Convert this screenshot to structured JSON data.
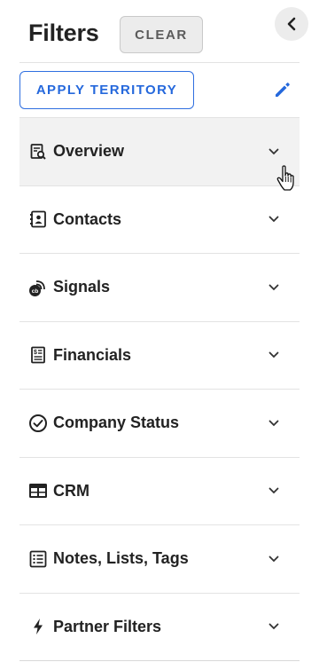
{
  "header": {
    "title": "Filters",
    "clear_label": "CLEAR"
  },
  "toolbar": {
    "apply_territory_label": "APPLY TERRITORY"
  },
  "sections": [
    {
      "label": "Overview",
      "icon": "overview-icon"
    },
    {
      "label": "Contacts",
      "icon": "contacts-icon"
    },
    {
      "label": "Signals",
      "icon": "signals-icon"
    },
    {
      "label": "Financials",
      "icon": "financials-icon"
    },
    {
      "label": "Company Status",
      "icon": "check-circle-icon"
    },
    {
      "label": "CRM",
      "icon": "crm-table-icon"
    },
    {
      "label": "Notes, Lists, Tags",
      "icon": "list-icon"
    },
    {
      "label": "Partner Filters",
      "icon": "bolt-icon"
    }
  ],
  "colors": {
    "accent": "#2568dc",
    "active_row": "#f2f2f2"
  }
}
